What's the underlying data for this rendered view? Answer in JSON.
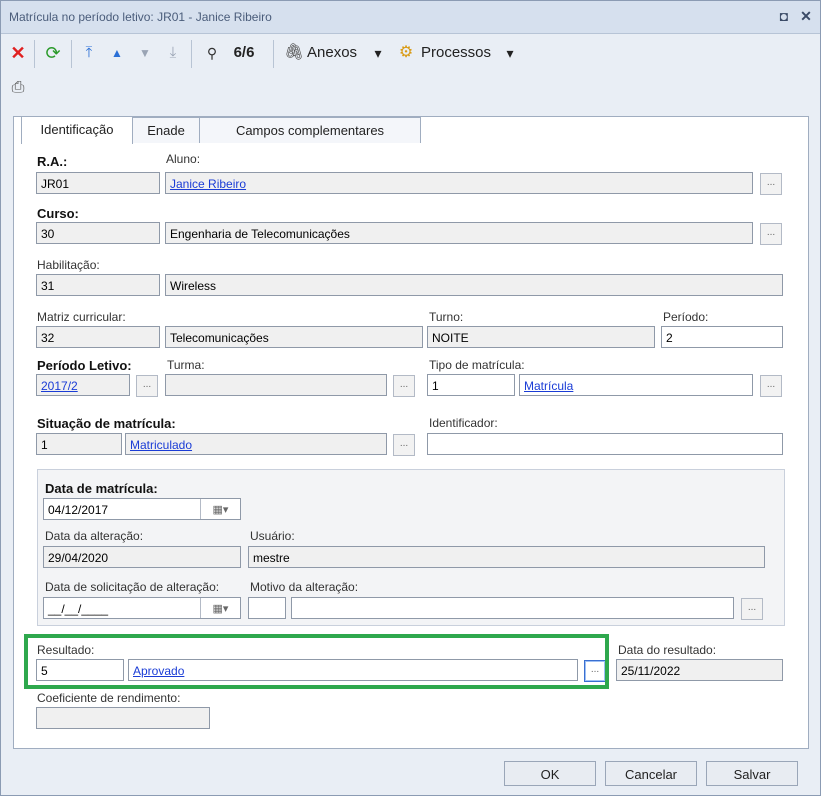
{
  "window": {
    "title": "Matrícula no período letivo: JR01 - Janice Ribeiro",
    "restore_glyph": "◘",
    "close_glyph": "✕"
  },
  "toolbar": {
    "record_counter": "6/6",
    "anexos_label": "Anexos",
    "processos_label": "Processos",
    "dropdown_glyph": "▾"
  },
  "tabs": [
    "Identificação",
    "Enade",
    "Campos complementares"
  ],
  "form": {
    "ra": {
      "label": "R.A.:",
      "value": "JR01"
    },
    "aluno": {
      "label": "Aluno:",
      "value": "Janice Ribeiro"
    },
    "curso": {
      "label": "Curso:",
      "code": "30",
      "name": "Engenharia de Telecomunicações"
    },
    "habilitacao": {
      "label": "Habilitação:",
      "code": "31",
      "name": "Wireless"
    },
    "matriz": {
      "label": "Matriz curricular:",
      "code": "32",
      "name": "Telecomunicações"
    },
    "turno": {
      "label": "Turno:",
      "value": "NOITE"
    },
    "periodo": {
      "label": "Período:",
      "value": "2"
    },
    "periodo_letivo": {
      "label": "Período Letivo:",
      "value": "2017/2"
    },
    "turma": {
      "label": "Turma:",
      "value": ""
    },
    "tipo_matricula": {
      "label": "Tipo de matrícula:",
      "code": "1",
      "name": "Matrícula"
    },
    "situacao": {
      "label": "Situação de matrícula:",
      "code": "1",
      "name": "Matriculado"
    },
    "identificador": {
      "label": "Identificador:",
      "value": ""
    },
    "data_matricula": {
      "label": "Data de matrícula:",
      "value": "04/12/2017"
    },
    "data_alteracao": {
      "label": "Data da alteração:",
      "value": "29/04/2020"
    },
    "usuario": {
      "label": "Usuário:",
      "value": "mestre"
    },
    "data_solicitacao": {
      "label": "Data de solicitação de alteração:",
      "value": "__/__/____"
    },
    "motivo": {
      "label": "Motivo da alteração:",
      "code": "",
      "value": ""
    },
    "resultado": {
      "label": "Resultado:",
      "code": "5",
      "name": "Aprovado"
    },
    "data_resultado": {
      "label": "Data do resultado:",
      "value": "25/11/2022"
    },
    "coeficiente": {
      "label": "Coeficiente de rendimento:",
      "value": ""
    },
    "ellipsis": "...",
    "calendar_glyph": "▦▾"
  },
  "buttons": {
    "ok": "OK",
    "cancel": "Cancelar",
    "save": "Salvar"
  },
  "colors": {
    "link": "#1a3cd6",
    "highlight": "#2ea84d",
    "delete": "#e02020",
    "refresh": "#2a9a2a",
    "nav": "#2a6fd6"
  }
}
